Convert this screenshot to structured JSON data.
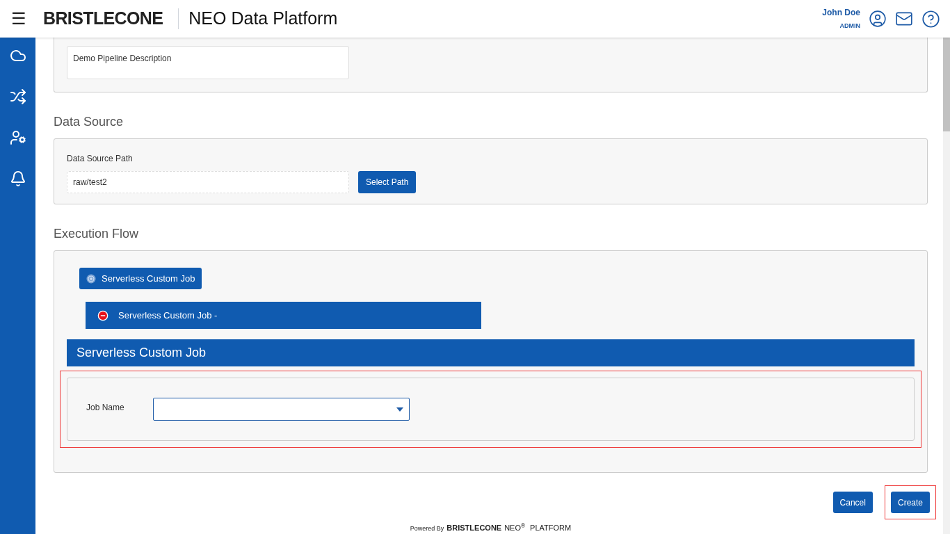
{
  "header": {
    "menu": "☰",
    "brand": "BRISTLECONE",
    "title": "NEO Data Platform",
    "user": {
      "name": "John Doe",
      "role": "ADMIN"
    }
  },
  "sidebar": {
    "items": [
      {
        "kind": "cloud"
      },
      {
        "kind": "flow"
      },
      {
        "kind": "admin"
      },
      {
        "kind": "bell"
      }
    ]
  },
  "pipeline": {
    "description": {
      "value": "Demo Pipeline Description"
    }
  },
  "data_source": {
    "heading": "Data Source",
    "label": "Data Source Path",
    "path": {
      "value": "raw/test2"
    },
    "button": "Select Path"
  },
  "execution_flow": {
    "heading": "Execution Flow",
    "job_chip": "Serverless Custom Job",
    "job_row": "Serverless Custom Job -",
    "panel_title": "Serverless Custom Job",
    "form": {
      "highlighted": true,
      "job_name_label": "Job Name"
    }
  },
  "actions": [
    {
      "label": "Cancel",
      "highlighted": false
    },
    {
      "label": "Create",
      "highlighted": true
    }
  ],
  "footer": {
    "powered_by": "Powered By",
    "brand": "BRISTLECONE",
    "product": "NEO",
    "mark": "®",
    "platform": "PLATFORM"
  }
}
